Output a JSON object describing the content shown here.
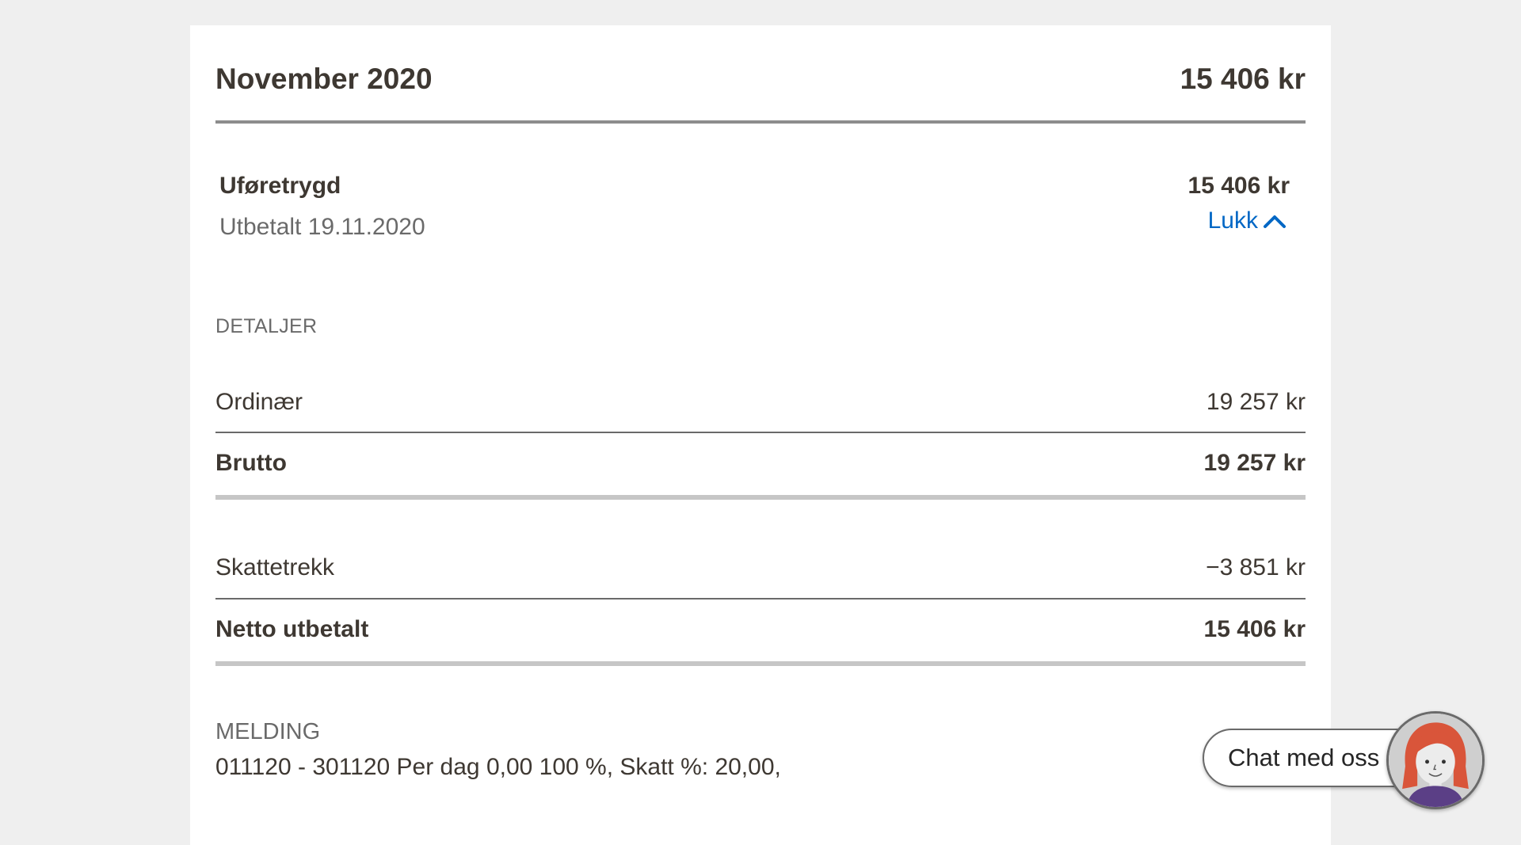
{
  "month": {
    "title": "November 2020",
    "total": "15 406 kr"
  },
  "payment": {
    "name": "Uføretrygd",
    "paid_date": "Utbetalt 19.11.2020",
    "amount": "15 406 kr",
    "toggle_label": "Lukk",
    "toggle_icon": "chevron-up-icon"
  },
  "details": {
    "label": "DETALJER",
    "rows": [
      {
        "label": "Ordinær",
        "value": "19 257 kr"
      }
    ],
    "gross": {
      "label": "Brutto",
      "value": "19 257 kr"
    }
  },
  "deductions": {
    "rows": [
      {
        "label": "Skattetrekk",
        "value": "−3 851 kr"
      }
    ],
    "net": {
      "label": "Netto utbetalt",
      "value": "15 406 kr"
    }
  },
  "message": {
    "label": "MELDING",
    "text": "011120 - 301120 Per dag 0,00 100 %, Skatt %: 20,00,"
  },
  "chat": {
    "label": "Chat med oss",
    "avatar_icon": "chat-avatar-icon"
  },
  "colors": {
    "page_background": "#efefef",
    "card_background": "#ffffff",
    "link": "#0067c5",
    "text": "#3e3832",
    "muted_text": "#6a6a6a"
  }
}
